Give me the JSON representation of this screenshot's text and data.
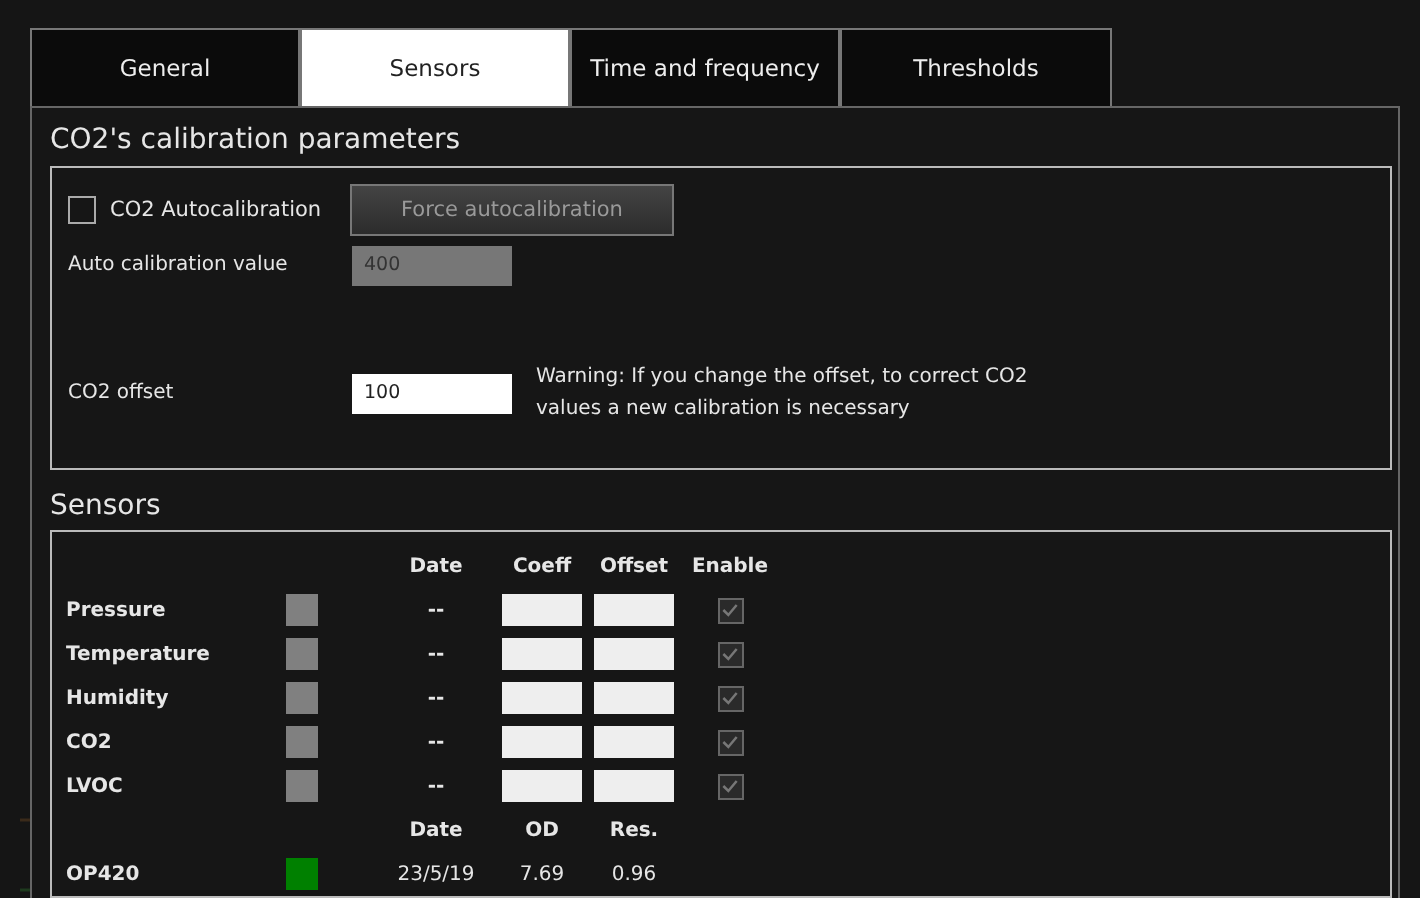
{
  "tabs": [
    {
      "label": "General",
      "selected": false
    },
    {
      "label": "Sensors",
      "selected": true
    },
    {
      "label": "Time and frequency",
      "selected": false
    },
    {
      "label": "Thresholds",
      "selected": false
    }
  ],
  "calibration": {
    "title": "CO2's calibration parameters",
    "autocalibration": {
      "label": "CO2 Autocalibration",
      "checked": false
    },
    "force_button": {
      "label": "Force autocalibration",
      "disabled": true
    },
    "auto_value": {
      "label": "Auto calibration value",
      "value": "400",
      "disabled": true
    },
    "offset": {
      "label": "CO2 offset",
      "value": "100",
      "disabled": false
    },
    "warning": "Warning: If you change the offset, to correct CO2 values a new calibration is necessary"
  },
  "sensors": {
    "title": "Sensors",
    "columns": [
      "Date",
      "Coeff",
      "Offset",
      "Enable"
    ],
    "rows": [
      {
        "name": "Pressure",
        "color": "#808080",
        "date": "--",
        "checked": true,
        "disabled": true
      },
      {
        "name": "Temperature",
        "color": "#808080",
        "date": "--",
        "checked": true,
        "disabled": true
      },
      {
        "name": "Humidity",
        "color": "#808080",
        "date": "--",
        "checked": true,
        "disabled": true
      },
      {
        "name": "CO2",
        "color": "#808080",
        "date": "--",
        "checked": true,
        "disabled": true
      },
      {
        "name": "LVOC",
        "color": "#808080",
        "date": "--",
        "checked": true,
        "disabled": true
      }
    ],
    "op_columns": [
      "Date",
      "OD",
      "Res."
    ],
    "op_rows": [
      {
        "name": "OP420",
        "color": "#008000",
        "date": "23/5/19",
        "od": "7.69",
        "res": "0.96"
      }
    ]
  }
}
